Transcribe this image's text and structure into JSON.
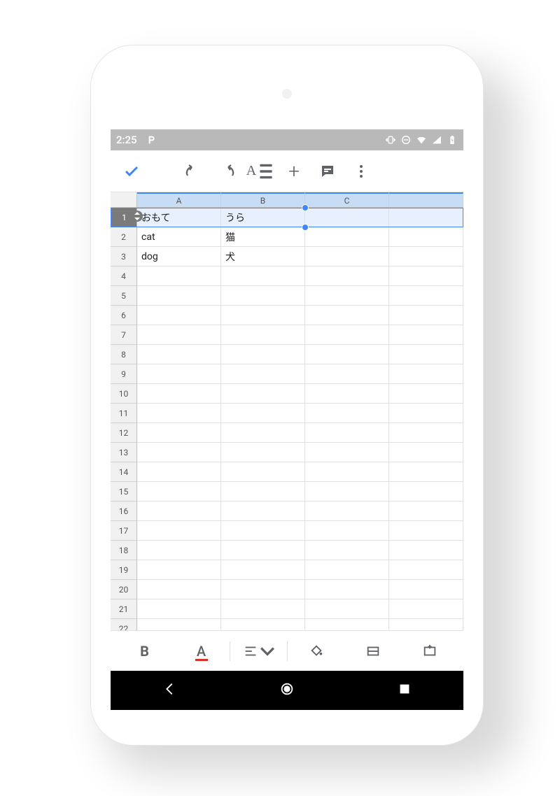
{
  "statusbar": {
    "time": "2:25"
  },
  "sheet": {
    "columns": [
      "A",
      "B",
      "C"
    ],
    "selected_row": 1,
    "row_count": 23,
    "cells": {
      "1": {
        "A": "おもて",
        "B": "うら",
        "C": ""
      },
      "2": {
        "A": "cat",
        "B": "猫",
        "C": ""
      },
      "3": {
        "A": "dog",
        "B": "犬",
        "C": ""
      }
    }
  }
}
